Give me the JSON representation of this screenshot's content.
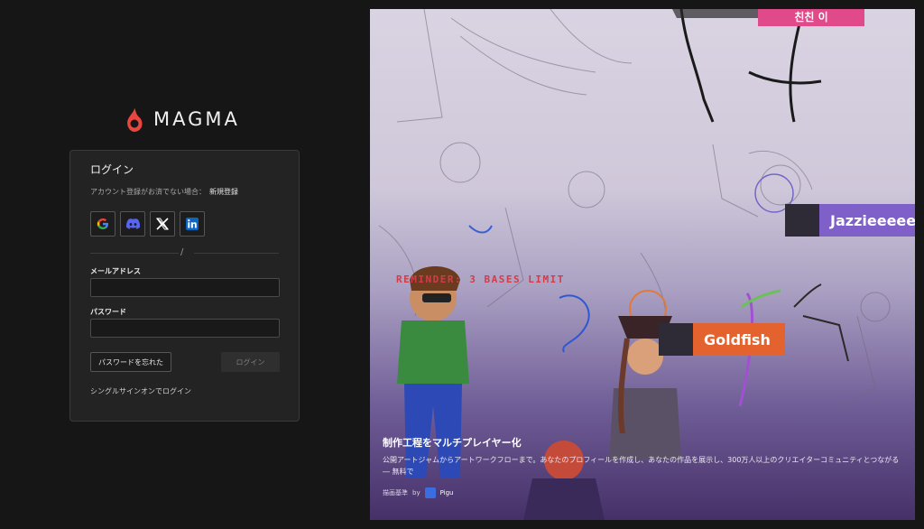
{
  "brand": {
    "name": "MAGMA",
    "logo_icon": "flame-icon",
    "accent": "#e8463f"
  },
  "login_card": {
    "title": "ログイン",
    "no_account_text": "アカウント登録がお済でない場合：",
    "signup_link": "新規登録",
    "social": [
      {
        "name": "google",
        "icon": "google-icon"
      },
      {
        "name": "discord",
        "icon": "discord-icon"
      },
      {
        "name": "x",
        "icon": "x-icon"
      },
      {
        "name": "linkedin",
        "icon": "linkedin-icon"
      }
    ],
    "divider_text": "/",
    "email_label": "メールアドレス",
    "email_value": "",
    "password_label": "パスワード",
    "password_value": "",
    "forgot_button": "パスワードを忘れた",
    "login_button": "ログイン",
    "sso_link": "シングルサインオンでログイン"
  },
  "showcase": {
    "tags": [
      "Jazzieeeee",
      "Goldfish"
    ],
    "top_tag": "친친 이",
    "reminder": "REMINDER: 3 BASES LIMIT",
    "title": "制作工程をマルチプレイヤー化",
    "description": "公開アートジャムからアートワークフローまで。あなたのプロフィールを作成し、あなたの作品を展示し、300万人以上のクリエイターコミュニティとつながる ― 無料で",
    "credit_prefix": "描画基準",
    "credit_by": "by",
    "credit_name": "Pigu"
  }
}
